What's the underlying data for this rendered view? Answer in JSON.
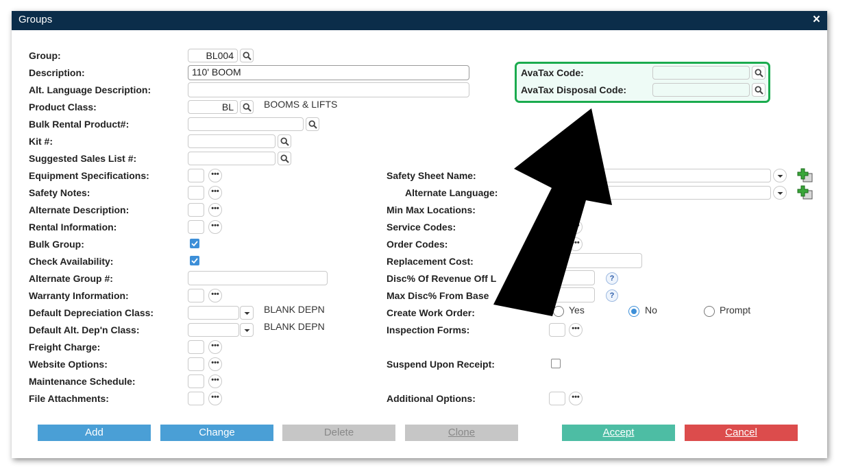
{
  "window": {
    "title": "Groups",
    "close": "×"
  },
  "fields": {
    "group": {
      "label": "Group:",
      "value": "BL004"
    },
    "description": {
      "label": "Description:",
      "value": "110' BOOM"
    },
    "alt_language_description": {
      "label": "Alt. Language Description:",
      "value": ""
    },
    "product_class": {
      "label": "Product Class:",
      "value": "BL",
      "desc": "BOOMS & LIFTS"
    },
    "bulk_rental_product": {
      "label": "Bulk Rental Product#:",
      "value": ""
    },
    "kit": {
      "label": "Kit #:",
      "value": ""
    },
    "suggested_sales_list": {
      "label": "Suggested Sales List #:",
      "value": ""
    },
    "equipment_specifications": {
      "label": "Equipment Specifications:"
    },
    "safety_notes": {
      "label": "Safety Notes:"
    },
    "alternate_description": {
      "label": "Alternate Description:"
    },
    "rental_information": {
      "label": "Rental Information:"
    },
    "bulk_group": {
      "label": "Bulk Group:",
      "checked": true
    },
    "check_availability": {
      "label": "Check Availability:",
      "checked": true
    },
    "alternate_group": {
      "label": "Alternate Group #:",
      "value": ""
    },
    "warranty_information": {
      "label": "Warranty Information:"
    },
    "default_depreciation_class": {
      "label": "Default Depreciation Class:",
      "desc": "BLANK DEPN"
    },
    "default_alt_depn_class": {
      "label": "Default Alt. Dep'n Class:",
      "desc": "BLANK DEPN"
    },
    "freight_charge": {
      "label": "Freight Charge:"
    },
    "website_options": {
      "label": "Website Options:"
    },
    "maintenance_schedule": {
      "label": "Maintenance Schedule:"
    },
    "file_attachments": {
      "label": "File Attachments:"
    },
    "avatax_code": {
      "label": "AvaTax Code:",
      "value": ""
    },
    "avatax_disposal_code": {
      "label": "AvaTax Disposal Code:",
      "value": ""
    },
    "safety_sheet_name": {
      "label": "Safety Sheet Name:",
      "value": ""
    },
    "alternate_language": {
      "label": "Alternate Language:",
      "value": ""
    },
    "min_max_locations": {
      "label": "Min Max Locations:"
    },
    "service_codes": {
      "label": "Service Codes:"
    },
    "order_codes": {
      "label": "Order Codes:"
    },
    "replacement_cost": {
      "label": "Replacement Cost:",
      "value": ""
    },
    "disc_revenue_off": {
      "label": "Disc% Of Revenue Off L",
      "value": ""
    },
    "max_disc_from_base": {
      "label": "Max Disc% From Base",
      "value": ""
    },
    "create_work_order": {
      "label": "Create Work Order:",
      "options": [
        "Yes",
        "No",
        "Prompt"
      ],
      "selected": "No"
    },
    "inspection_forms": {
      "label": "Inspection Forms:"
    },
    "suspend_upon_receipt": {
      "label": "Suspend Upon Receipt:",
      "checked": false
    },
    "additional_options": {
      "label": "Additional Options:"
    }
  },
  "icons": {
    "lookup": "magnifier-icon",
    "more": "ellipsis-icon",
    "dropdown": "chevron-down-icon",
    "help": "help-icon",
    "add": "green-plus-icon"
  },
  "ellipsis": "•••",
  "help_glyph": "?",
  "buttons": {
    "add": "Add",
    "change": "Change",
    "delete": "Delete",
    "clone": "Clone",
    "accept": "Accept",
    "cancel": "Cancel"
  },
  "colors": {
    "titlebar": "#0b2d4a",
    "highlight_border": "#1aab4e",
    "add_btn": "#4a9fd6",
    "accept_btn": "#4dbda4",
    "cancel_btn": "#dc4c4c",
    "disabled_btn": "#c6c6c6"
  }
}
